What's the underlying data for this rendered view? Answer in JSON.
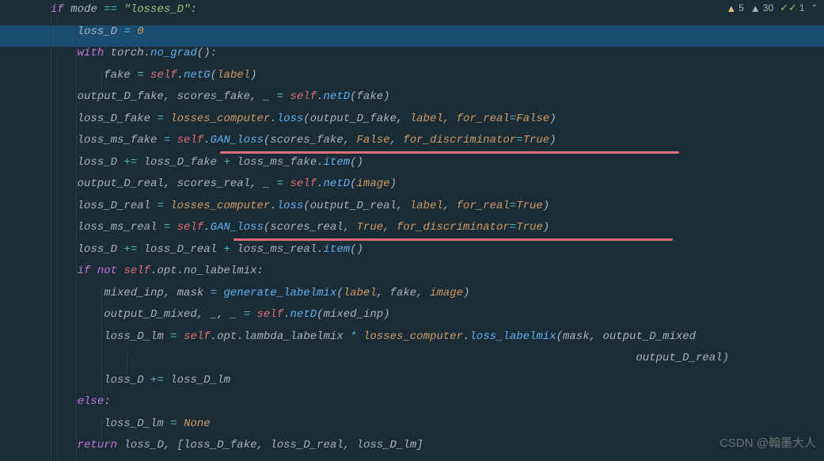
{
  "status": {
    "warn1_count": "5",
    "warn2_count": "30",
    "check_count": "1"
  },
  "code": {
    "line1": {
      "kw_if": "if",
      "var_mode": "mode",
      "op_eq": "==",
      "str_losses": "\"losses_D\"",
      "colon": ":"
    },
    "line2": {
      "var_lossD": "loss_D",
      "op_assign": "=",
      "num_zero": "0"
    },
    "line3": {
      "kw_with": "with",
      "var_torch": "torch",
      "fn_nograd": "no_grad",
      "parens": "():"
    },
    "line4": {
      "var_fake": "fake",
      "op_assign": "=",
      "self": "self",
      "fn_netG": "netG",
      "param_label": "label"
    },
    "line5": {
      "var_out": "output_D_fake",
      "comma1": ",",
      "var_scores": "scores_fake",
      "comma2": ",",
      "var_us": "_",
      "op_assign": "=",
      "self": "self",
      "fn_netD": "netD",
      "var_fake": "fake"
    },
    "line6": {
      "var_loss": "loss_D_fake",
      "op_assign": "=",
      "var_lc": "losses_computer",
      "fn_loss": "loss",
      "arg1": "output_D_fake",
      "param_label": "label",
      "param_forreal": "for_real",
      "const_false": "False"
    },
    "line7": {
      "var_loss": "loss_ms_fake",
      "op_assign": "=",
      "self": "self",
      "fn_gan": "GAN_loss",
      "arg1": "scores_fake",
      "const_false": "False",
      "param_fd": "for_discriminator",
      "const_true": "True"
    },
    "line8": {
      "var_lossD": "loss_D",
      "op_pe": "+=",
      "var_ldf": "loss_D_fake",
      "op_plus": "+",
      "var_lmf": "loss_ms_fake",
      "fn_item": "item"
    },
    "line9": {
      "var_out": "output_D_real",
      "comma1": ",",
      "var_scores": "scores_real",
      "comma2": ",",
      "var_us": "_",
      "op_assign": "=",
      "self": "self",
      "fn_netD": "netD",
      "param_image": "image"
    },
    "line10": {
      "var_loss": "loss_D_real",
      "op_assign": "=",
      "var_lc": "losses_computer",
      "fn_loss": "loss",
      "arg1": "output_D_real",
      "param_label": "label",
      "param_forreal": "for_real",
      "const_true": "True"
    },
    "line11": {
      "var_loss": "loss_ms_real",
      "op_assign": "=",
      "self": "self",
      "fn_gan": "GAN_loss",
      "arg1": "scores_real",
      "const_true": "True",
      "param_fd": "for_discriminator",
      "const_true2": "True"
    },
    "line12": {
      "var_lossD": "loss_D",
      "op_pe": "+=",
      "var_ldr": "loss_D_real",
      "op_plus": "+",
      "var_lmr": "loss_ms_real",
      "fn_item": "item"
    },
    "line13": {
      "kw_if": "if",
      "kw_not": "not",
      "self": "self",
      "var_opt": "opt",
      "var_nlm": "no_labelmix",
      "colon": ":"
    },
    "line14": {
      "var_mi": "mixed_inp",
      "comma": ",",
      "var_mask": "mask",
      "op_assign": "=",
      "fn_gl": "generate_labelmix",
      "param_label": "label",
      "var_fake": "fake",
      "param_image": "image"
    },
    "line15": {
      "var_out": "output_D_mixed",
      "comma1": ",",
      "var_us1": "_",
      "comma2": ",",
      "var_us2": "_",
      "op_assign": "=",
      "self": "self",
      "fn_netD": "netD",
      "var_mi": "mixed_inp"
    },
    "line16": {
      "var_loss": "loss_D_lm",
      "op_assign": "=",
      "self": "self",
      "var_opt": "opt",
      "var_ll": "lambda_labelmix",
      "op_mult": "*",
      "var_lc": "losses_computer",
      "fn_ll": "loss_labelmix",
      "var_mask": "mask",
      "var_odm": "output_D_mixed"
    },
    "line17": {
      "var_odr": "output_D_real"
    },
    "line18": {
      "var_lossD": "loss_D",
      "op_pe": "+=",
      "var_ldlm": "loss_D_lm"
    },
    "line19": {
      "kw_else": "else",
      "colon": ":"
    },
    "line20": {
      "var_ldlm": "loss_D_lm",
      "op_assign": "=",
      "const_none": "None"
    },
    "line21": {
      "kw_return": "return",
      "var_lossD": "loss_D",
      "comma": ",",
      "br_open": "[",
      "var_ldf": "loss_D_fake",
      "comma2": ",",
      "var_ldr": "loss_D_real",
      "comma3": ",",
      "var_ldlm": "loss_D_lm",
      "br_close": "]"
    }
  },
  "watermark": "CSDN @翰墨大人"
}
